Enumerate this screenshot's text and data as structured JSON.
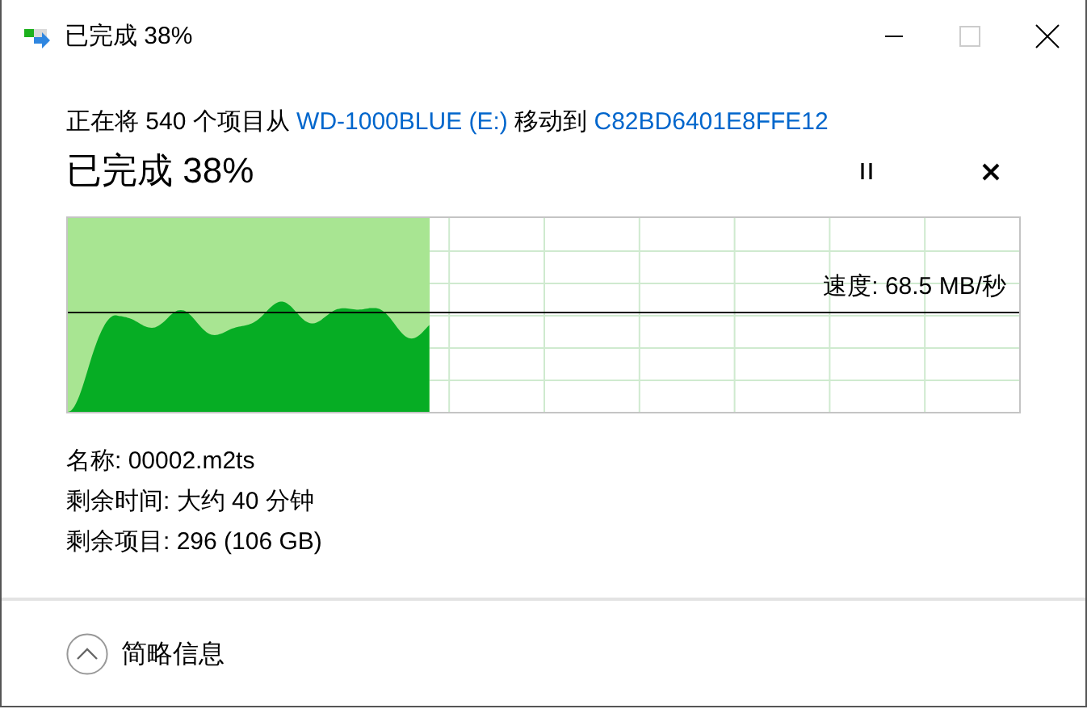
{
  "window": {
    "title": "已完成 38%"
  },
  "status": [
    {
      "kind": "text",
      "text": "正在将 540 个项目从 "
    },
    {
      "kind": "link",
      "text": "WD-1000BLUE (E:)"
    },
    {
      "kind": "text",
      "text": " 移动到 "
    },
    {
      "kind": "link",
      "text": "C82BD6401E8FFE12"
    }
  ],
  "heading": "已完成 38%",
  "progress": {
    "level": 0.38,
    "speed": "速度: 68.5 MB/秒"
  },
  "details": [
    "名称: 00002.m2ts",
    "剩余时间: 大约 40 分钟",
    "剩余项目: 296 (106 GB)"
  ],
  "footer": {
    "label": "简略信息",
    "expanded": true
  }
}
